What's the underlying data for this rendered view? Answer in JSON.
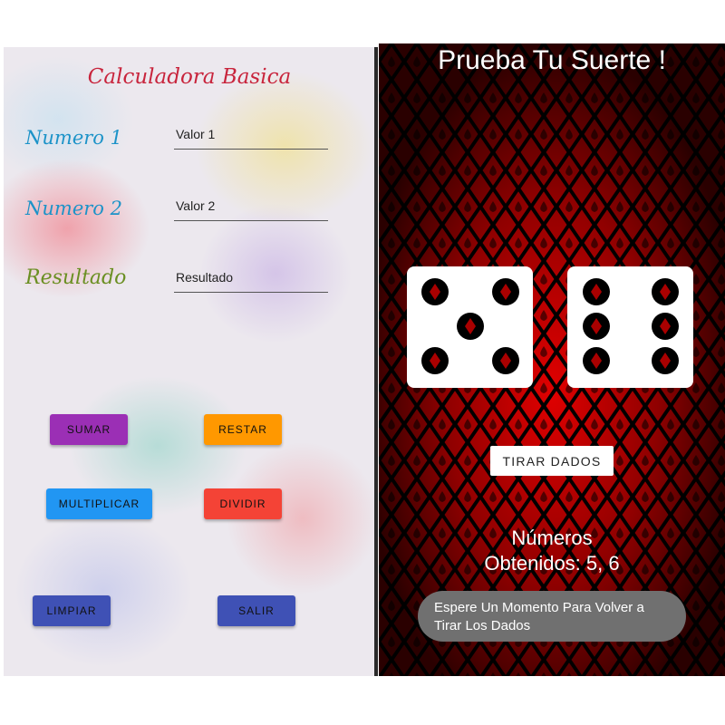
{
  "calculator": {
    "title": "Calculadora Basica",
    "fields": [
      {
        "label": "Numero 1",
        "label_color": "#1c93c8",
        "placeholder": "Valor 1"
      },
      {
        "label": "Numero 2",
        "label_color": "#1c93c8",
        "placeholder": "Valor 2"
      },
      {
        "label": "Resultado",
        "label_color": "#6a8f22",
        "placeholder": "Resultado"
      }
    ],
    "buttons": {
      "sumar": {
        "label": "SUMAR",
        "color": "#9b2fb5"
      },
      "restar": {
        "label": "RESTAR",
        "color": "#ff9800"
      },
      "multiplicar": {
        "label": "MULTIPLICAR",
        "color": "#2196f3"
      },
      "dividir": {
        "label": "DIVIDIR",
        "color": "#f44336"
      },
      "limpiar": {
        "label": "LIMPIAR",
        "color": "#3f51b5"
      },
      "salir": {
        "label": "SALIR",
        "color": "#3f51b5"
      }
    }
  },
  "dice_app": {
    "title": "Prueba Tu Suerte !",
    "dice_values": [
      5,
      6
    ],
    "roll_button": "TIRAR DADOS",
    "result_line1": "Números",
    "result_line2": "Obtenidos: 5, 6",
    "toast": "Espere Un Momento Para Volver a Tirar Los Dados",
    "background_color": "#b00000"
  }
}
